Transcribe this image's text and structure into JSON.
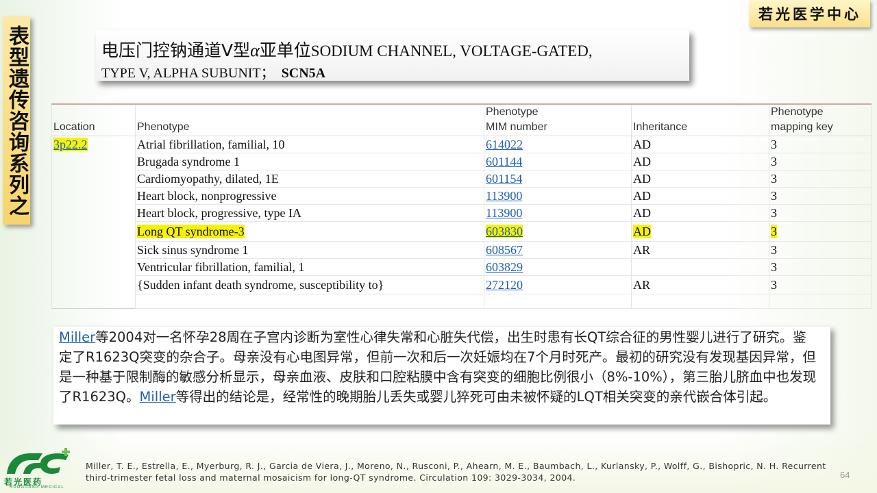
{
  "series_tab": "表型遗传咨询系列之",
  "brand": "若光医学中心",
  "title": {
    "cn": "电压门控钠通道V型",
    "alpha": "α",
    "cn2": "亚单位",
    "en1": "SODIUM CHANNEL, VOLTAGE-GATED,",
    "en2": "TYPE V, ALPHA SUBUNIT；",
    "gene": "SCN5A"
  },
  "table": {
    "headers": {
      "location": "Location",
      "phenotype": "Phenotype",
      "mim_line1": "Phenotype",
      "mim_line2": "MIM number",
      "inheritance": "Inheritance",
      "key_line1": "Phenotype",
      "key_line2": "mapping key"
    },
    "location": "3p22.2",
    "rows": [
      {
        "phenotype": "Atrial fibrillation, familial, 10",
        "mim": "614022",
        "inheritance": "AD",
        "key": "3"
      },
      {
        "phenotype": "Brugada syndrome 1",
        "mim": "601144",
        "inheritance": "AD",
        "key": "3"
      },
      {
        "phenotype": "Cardiomyopathy, dilated, 1E",
        "mim": "601154",
        "inheritance": "AD",
        "key": "3"
      },
      {
        "phenotype": "Heart block, nonprogressive",
        "mim": "113900",
        "inheritance": "AD",
        "key": "3"
      },
      {
        "phenotype": "Heart block, progressive, type IA",
        "mim": "113900",
        "inheritance": "AD",
        "key": "3"
      },
      {
        "phenotype": "Long QT syndrome-3",
        "mim": "603830",
        "inheritance": "AD",
        "key": "3"
      },
      {
        "phenotype": "Sick sinus syndrome 1",
        "mim": "608567",
        "inheritance": "AR",
        "key": "3"
      },
      {
        "phenotype": "Ventricular fibrillation, familial, 1",
        "mim": "603829",
        "inheritance": "",
        "key": "3"
      },
      {
        "phenotype": "{Sudden infant death syndrome, susceptibility to}",
        "mim": "272120",
        "inheritance": "AR",
        "key": "3"
      }
    ]
  },
  "description": {
    "link1": "Miller",
    "text1": "等2004对一名怀孕28周在子宫内诊断为室性心律失常和心脏失代偿，出生时患有长QT综合征的男性婴儿进行了研究。鉴定了R1623Q突变的杂合子。母亲没有心电图异常，但前一次和后一次妊娠均在7个月时死产。最初的研究没有发现基因异常，但是一种基于限制酶的敏感分析显示，母亲血液、皮肤和口腔粘膜中含有突变的细胞比例很小（8%-10%），第三胎儿脐血中也发现了R1623Q。",
    "link2": "Miller",
    "text2": "等得出的结论是，经常性的晚期胎儿丢失或婴儿猝死可由未被怀疑的LQT相关突变的亲代嵌合体引起。"
  },
  "logo": {
    "name": "若光医药",
    "sub": "RUOGUANG MEDICAL"
  },
  "citation": "Miller, T. E., Estrella, E., Myerburg, R. J., Garcia de Viera, J., Moreno, N., Rusconi, P., Ahearn, M. E., Baumbach, L., Kurlansky, P., Wolff, G., Bishopric, N. H. Recurrent third-trimester fetal loss and maternal mosaicism for long-QT syndrome. Circulation 109: 3029-3034, 2004.",
  "page_number": "64",
  "colors": {
    "highlight": "#f5f20a",
    "link": "#1f5fb3",
    "tab_gold": "#f7d46c",
    "logo_green": "#1a8a3a"
  }
}
